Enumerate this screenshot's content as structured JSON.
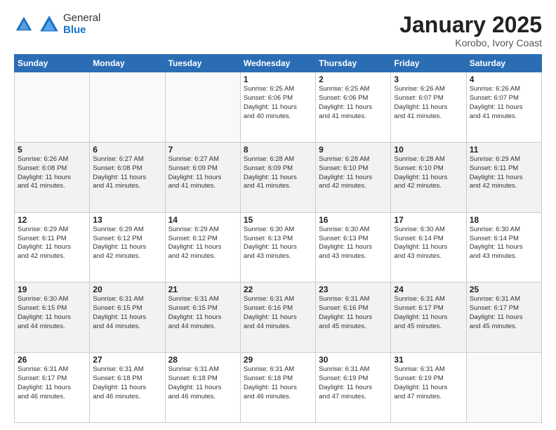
{
  "logo": {
    "general": "General",
    "blue": "Blue"
  },
  "header": {
    "month": "January 2025",
    "location": "Korobo, Ivory Coast"
  },
  "weekdays": [
    "Sunday",
    "Monday",
    "Tuesday",
    "Wednesday",
    "Thursday",
    "Friday",
    "Saturday"
  ],
  "rows": [
    [
      {
        "day": "",
        "info": ""
      },
      {
        "day": "",
        "info": ""
      },
      {
        "day": "",
        "info": ""
      },
      {
        "day": "1",
        "info": "Sunrise: 6:25 AM\nSunset: 6:06 PM\nDaylight: 11 hours\nand 40 minutes."
      },
      {
        "day": "2",
        "info": "Sunrise: 6:25 AM\nSunset: 6:06 PM\nDaylight: 11 hours\nand 41 minutes."
      },
      {
        "day": "3",
        "info": "Sunrise: 6:26 AM\nSunset: 6:07 PM\nDaylight: 11 hours\nand 41 minutes."
      },
      {
        "day": "4",
        "info": "Sunrise: 6:26 AM\nSunset: 6:07 PM\nDaylight: 11 hours\nand 41 minutes."
      }
    ],
    [
      {
        "day": "5",
        "info": "Sunrise: 6:26 AM\nSunset: 6:08 PM\nDaylight: 11 hours\nand 41 minutes."
      },
      {
        "day": "6",
        "info": "Sunrise: 6:27 AM\nSunset: 6:08 PM\nDaylight: 11 hours\nand 41 minutes."
      },
      {
        "day": "7",
        "info": "Sunrise: 6:27 AM\nSunset: 6:09 PM\nDaylight: 11 hours\nand 41 minutes."
      },
      {
        "day": "8",
        "info": "Sunrise: 6:28 AM\nSunset: 6:09 PM\nDaylight: 11 hours\nand 41 minutes."
      },
      {
        "day": "9",
        "info": "Sunrise: 6:28 AM\nSunset: 6:10 PM\nDaylight: 11 hours\nand 42 minutes."
      },
      {
        "day": "10",
        "info": "Sunrise: 6:28 AM\nSunset: 6:10 PM\nDaylight: 11 hours\nand 42 minutes."
      },
      {
        "day": "11",
        "info": "Sunrise: 6:29 AM\nSunset: 6:11 PM\nDaylight: 11 hours\nand 42 minutes."
      }
    ],
    [
      {
        "day": "12",
        "info": "Sunrise: 6:29 AM\nSunset: 6:11 PM\nDaylight: 11 hours\nand 42 minutes."
      },
      {
        "day": "13",
        "info": "Sunrise: 6:29 AM\nSunset: 6:12 PM\nDaylight: 11 hours\nand 42 minutes."
      },
      {
        "day": "14",
        "info": "Sunrise: 6:29 AM\nSunset: 6:12 PM\nDaylight: 11 hours\nand 42 minutes."
      },
      {
        "day": "15",
        "info": "Sunrise: 6:30 AM\nSunset: 6:13 PM\nDaylight: 11 hours\nand 43 minutes."
      },
      {
        "day": "16",
        "info": "Sunrise: 6:30 AM\nSunset: 6:13 PM\nDaylight: 11 hours\nand 43 minutes."
      },
      {
        "day": "17",
        "info": "Sunrise: 6:30 AM\nSunset: 6:14 PM\nDaylight: 11 hours\nand 43 minutes."
      },
      {
        "day": "18",
        "info": "Sunrise: 6:30 AM\nSunset: 6:14 PM\nDaylight: 11 hours\nand 43 minutes."
      }
    ],
    [
      {
        "day": "19",
        "info": "Sunrise: 6:30 AM\nSunset: 6:15 PM\nDaylight: 11 hours\nand 44 minutes."
      },
      {
        "day": "20",
        "info": "Sunrise: 6:31 AM\nSunset: 6:15 PM\nDaylight: 11 hours\nand 44 minutes."
      },
      {
        "day": "21",
        "info": "Sunrise: 6:31 AM\nSunset: 6:15 PM\nDaylight: 11 hours\nand 44 minutes."
      },
      {
        "day": "22",
        "info": "Sunrise: 6:31 AM\nSunset: 6:16 PM\nDaylight: 11 hours\nand 44 minutes."
      },
      {
        "day": "23",
        "info": "Sunrise: 6:31 AM\nSunset: 6:16 PM\nDaylight: 11 hours\nand 45 minutes."
      },
      {
        "day": "24",
        "info": "Sunrise: 6:31 AM\nSunset: 6:17 PM\nDaylight: 11 hours\nand 45 minutes."
      },
      {
        "day": "25",
        "info": "Sunrise: 6:31 AM\nSunset: 6:17 PM\nDaylight: 11 hours\nand 45 minutes."
      }
    ],
    [
      {
        "day": "26",
        "info": "Sunrise: 6:31 AM\nSunset: 6:17 PM\nDaylight: 11 hours\nand 46 minutes."
      },
      {
        "day": "27",
        "info": "Sunrise: 6:31 AM\nSunset: 6:18 PM\nDaylight: 11 hours\nand 46 minutes."
      },
      {
        "day": "28",
        "info": "Sunrise: 6:31 AM\nSunset: 6:18 PM\nDaylight: 11 hours\nand 46 minutes."
      },
      {
        "day": "29",
        "info": "Sunrise: 6:31 AM\nSunset: 6:18 PM\nDaylight: 11 hours\nand 46 minutes."
      },
      {
        "day": "30",
        "info": "Sunrise: 6:31 AM\nSunset: 6:19 PM\nDaylight: 11 hours\nand 47 minutes."
      },
      {
        "day": "31",
        "info": "Sunrise: 6:31 AM\nSunset: 6:19 PM\nDaylight: 11 hours\nand 47 minutes."
      },
      {
        "day": "",
        "info": ""
      }
    ]
  ]
}
